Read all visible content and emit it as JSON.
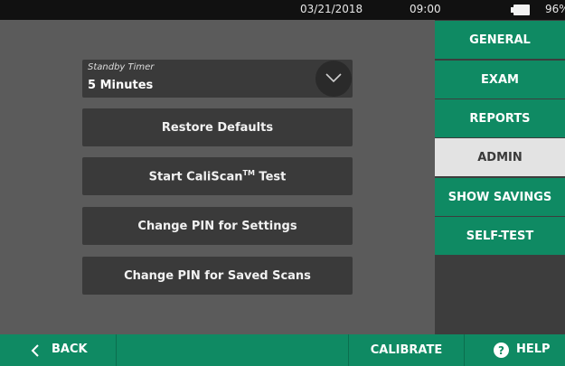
{
  "status_bar": {
    "date": "03/21/2018",
    "time": "09:00",
    "battery": "96%"
  },
  "standby": {
    "label": "Standby Timer",
    "value": "5 Minutes"
  },
  "buttons": {
    "restore": "Restore Defaults",
    "caliscan_prefix": "Start CaliScan",
    "caliscan_tm": "TM",
    "caliscan_suffix": " Test",
    "pin_settings": "Change PIN for Settings",
    "pin_scans": "Change PIN for Saved Scans"
  },
  "tabs": {
    "general": "GENERAL",
    "exam": "EXAM",
    "reports": "REPORTS",
    "admin": "ADMIN",
    "show_savings": "SHOW SAVINGS",
    "self_test": "SELF-TEST",
    "active": "ADMIN"
  },
  "bottom_nav": {
    "back": "BACK",
    "calibrate": "CALIBRATE",
    "help": "HELP",
    "help_glyph": "?"
  },
  "colors": {
    "accent": "#0f8a63",
    "panel_bg": "#5b5b5b",
    "button_bg": "#3a3a3a",
    "active_tab_bg": "#e3e3e3"
  },
  "icons": [
    "battery-icon",
    "chevron-down-icon",
    "chevron-left-icon",
    "help-icon"
  ]
}
